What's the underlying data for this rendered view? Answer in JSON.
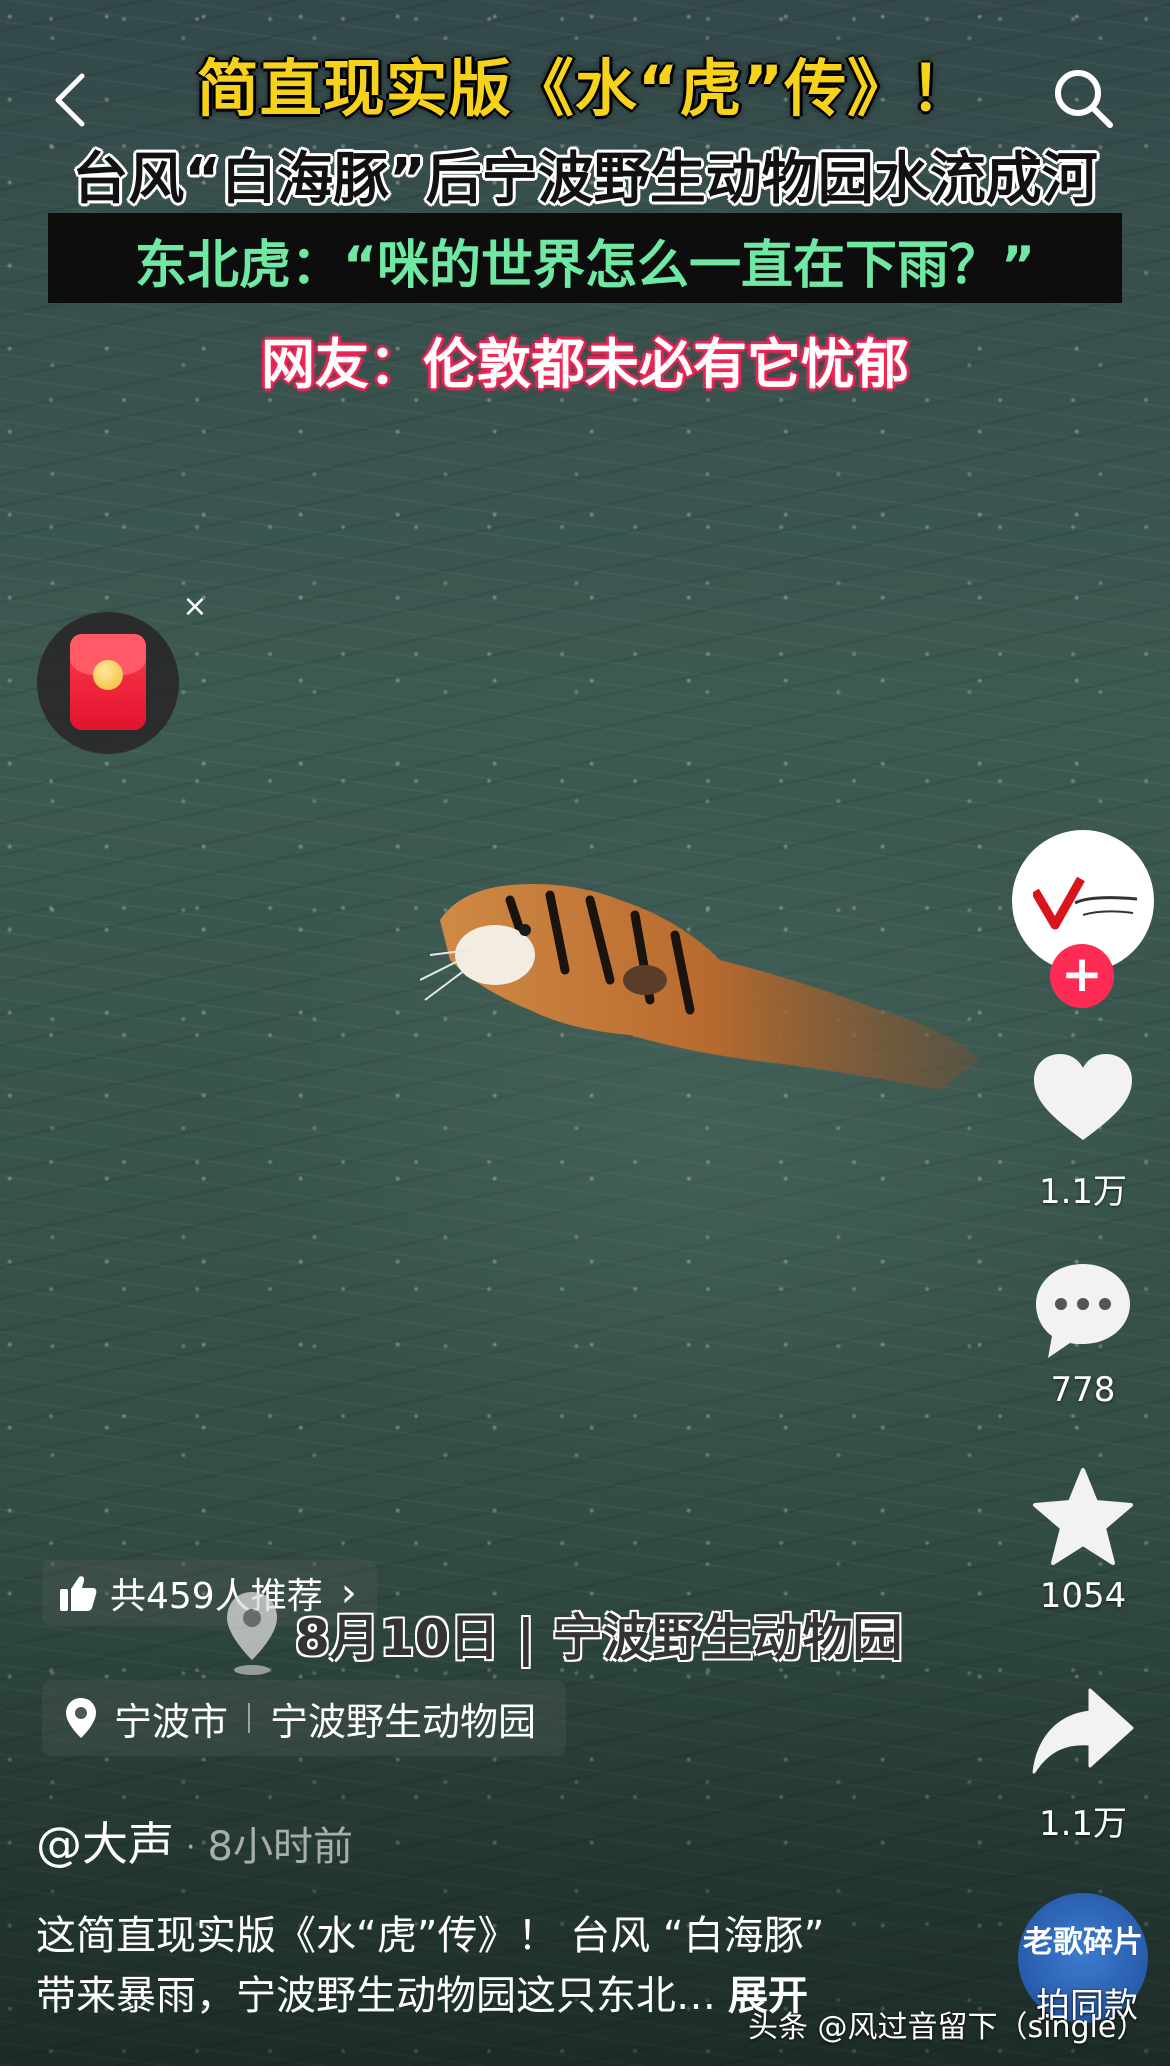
{
  "video": {
    "caption_line1": "简直现实版《水“虎”传》！",
    "caption_line2": "台风“白海豚”后宁波野生动物园水流成河",
    "caption_line3": "东北虎：“咪的世界怎么一直在下雨？”",
    "caption_line4": "网友：伦敦都未必有它忧郁",
    "overlay_tag": "8月10日 | 宁波野生动物园"
  },
  "redpack": {
    "close_label": "×"
  },
  "actions": {
    "likes": "1.1万",
    "comments": "778",
    "favorites": "1054",
    "shares": "1.1万",
    "follow_label": "+"
  },
  "recommend": {
    "text": "共459人推荐",
    "chevron": "›"
  },
  "location": {
    "city": "宁波市",
    "place": "宁波野生动物园"
  },
  "author": {
    "name": "@大声",
    "dot": "·",
    "time": "8小时前"
  },
  "description": {
    "line1": "这简直现实版《水“虎”传》！ 台风 “白海豚”",
    "line2": "带来暴雨，宁波野生动物园这只东北…",
    "more": "展开"
  },
  "music": {
    "disc_text": "老歌碎片",
    "same_style_label": "拍同款"
  },
  "watermark": "头条 @风过音留下（single）",
  "colors": {
    "caption_yellow": "#f7d21a",
    "caption_green": "#6fe8a4",
    "follow_red": "#fe2c55"
  }
}
